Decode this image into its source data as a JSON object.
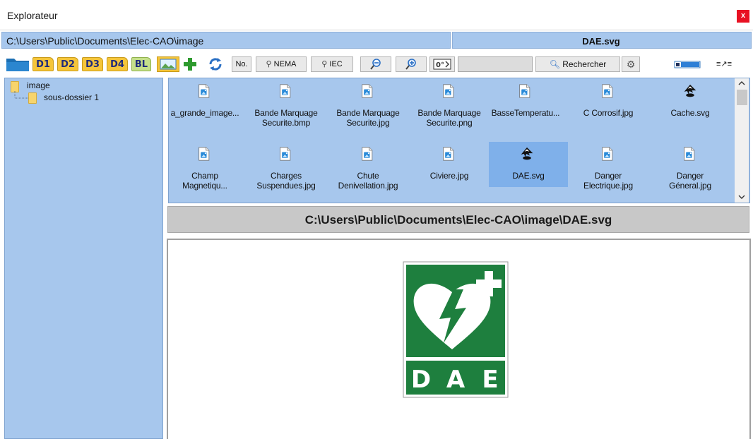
{
  "window": {
    "title": "Explorateur",
    "close_label": "x"
  },
  "path_bar": {
    "path": "C:\\Users\\Public\\Documents\\Elec-CAO\\image",
    "selected_file": "DAE.svg"
  },
  "toolbar": {
    "tabs": [
      "D1",
      "D2",
      "D3",
      "D4",
      "BL"
    ],
    "no_label": "No.",
    "nema_label": "NEMA",
    "iec_label": "IEC",
    "search_value": "",
    "search_label": "Rechercher",
    "list_toggle_label": "≡↗≡"
  },
  "tree": {
    "root": "image",
    "children": [
      "sous-dossier 1"
    ]
  },
  "files": [
    {
      "line1": "a_grande_image...",
      "line2": "",
      "icon": "image-file-icon"
    },
    {
      "line1": "Bande Marquage",
      "line2": "Securite.bmp",
      "icon": "image-file-icon"
    },
    {
      "line1": "Bande Marquage",
      "line2": "Securite.jpg",
      "icon": "image-file-icon"
    },
    {
      "line1": "Bande Marquage",
      "line2": "Securite.png",
      "icon": "image-file-icon"
    },
    {
      "line1": "BasseTemperatu...",
      "line2": "",
      "icon": "image-file-icon"
    },
    {
      "line1": "C Corrosif.jpg",
      "line2": "",
      "icon": "image-file-icon"
    },
    {
      "line1": "Cache.svg",
      "line2": "",
      "icon": "inkscape-icon"
    },
    {
      "line1": "Champ",
      "line2": "Magnetiqu...",
      "icon": "image-file-icon"
    },
    {
      "line1": "Charges",
      "line2": "Suspendues.jpg",
      "icon": "image-file-icon"
    },
    {
      "line1": "Chute",
      "line2": "Denivellation.jpg",
      "icon": "image-file-icon"
    },
    {
      "line1": "Civiere.jpg",
      "line2": "",
      "icon": "image-file-icon"
    },
    {
      "line1": "DAE.svg",
      "line2": "",
      "icon": "inkscape-icon"
    },
    {
      "line1": "Danger",
      "line2": "Electrique.jpg",
      "icon": "image-file-icon"
    },
    {
      "line1": "Danger",
      "line2": "Géneral.jpg",
      "icon": "image-file-icon"
    }
  ],
  "full_path": "C:\\Users\\Public\\Documents\\Elec-CAO\\image\\DAE.svg",
  "preview": {
    "sign_text": "DAE",
    "letters": [
      "D",
      "A",
      "E"
    ],
    "sign_color": "#1e7f3e"
  },
  "colors": {
    "panel_blue": "#a7c7ed",
    "selection": "#7fb0ea",
    "close_red": "#e81123"
  }
}
